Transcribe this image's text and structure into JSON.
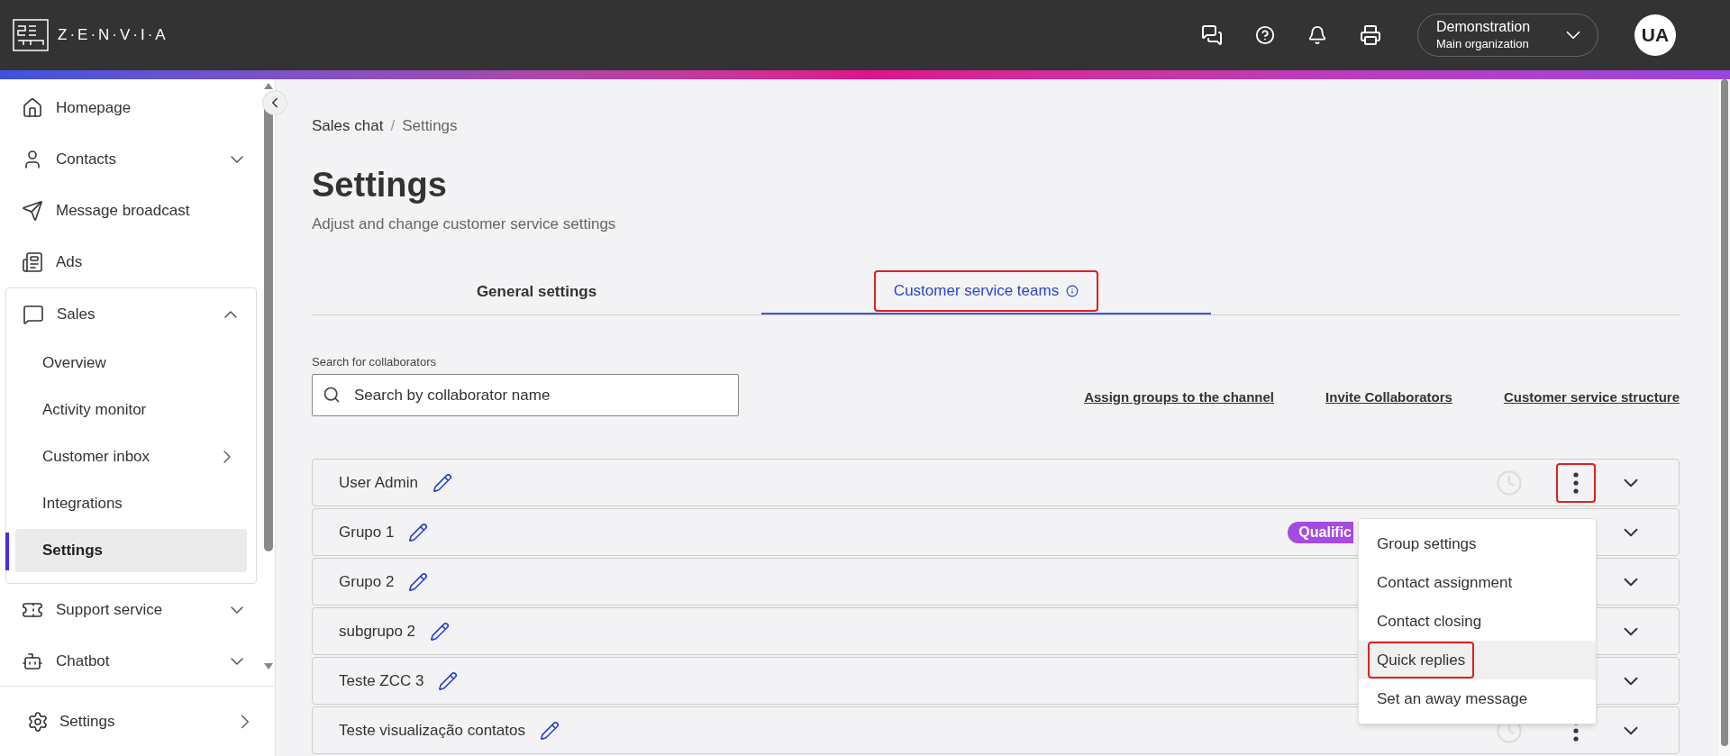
{
  "header": {
    "logo_text": "Z·E·N·V·I·A",
    "org_name": "Demonstration",
    "org_sub": "Main organization",
    "avatar": "UA"
  },
  "sidebar": {
    "items": [
      {
        "label": "Homepage",
        "selected": false
      },
      {
        "label": "Contacts",
        "selected": false,
        "expanded": false
      },
      {
        "label": "Message broadcast",
        "selected": false
      },
      {
        "label": "Ads",
        "selected": false
      },
      {
        "label": "Sales",
        "selected": false,
        "expanded": true,
        "children": [
          {
            "label": "Overview",
            "selected": false,
            "submenu": false
          },
          {
            "label": "Activity monitor",
            "selected": false,
            "submenu": false
          },
          {
            "label": "Customer inbox",
            "selected": false,
            "submenu": true
          },
          {
            "label": "Integrations",
            "selected": false,
            "submenu": false
          },
          {
            "label": "Settings",
            "selected": true,
            "submenu": false
          }
        ]
      },
      {
        "label": "Support service",
        "selected": false,
        "expanded": false
      },
      {
        "label": "Chatbot",
        "selected": false,
        "expanded": false
      }
    ],
    "footer": "Settings"
  },
  "breadcrumb": [
    "Sales chat",
    "Settings"
  ],
  "breadcrumb_separator": "/",
  "title": "Settings",
  "subtitle": "Adjust and change customer service settings",
  "tabs": [
    {
      "label": "General settings",
      "selected": false,
      "highlighted": false
    },
    {
      "label": "Customer service teams",
      "selected": true,
      "highlighted": true
    }
  ],
  "search": {
    "label": "Search for collaborators",
    "placeholder": "Search by collaborator name"
  },
  "links": [
    "Assign groups to the channel",
    "Invite Collaborators",
    "Customer service structure"
  ],
  "groups": [
    {
      "name": "User Admin",
      "actions": true,
      "highlighted": true
    },
    {
      "name": "Grupo 1",
      "tag": "Qualific",
      "highlighted": false
    },
    {
      "name": "Grupo 2",
      "highlighted": false
    },
    {
      "name": "subgrupo 2",
      "highlighted": false
    },
    {
      "name": "Teste ZCC 3",
      "highlighted": false
    },
    {
      "name": "Teste visualização contatos",
      "actions": true,
      "highlighted": false
    }
  ],
  "menu": {
    "items": [
      {
        "label": "Group settings",
        "selected": false,
        "highlighted": false
      },
      {
        "label": "Contact assignment",
        "selected": false,
        "highlighted": false
      },
      {
        "label": "Contact closing",
        "selected": false,
        "highlighted": false
      },
      {
        "label": "Quick replies",
        "selected": true,
        "highlighted": true
      },
      {
        "label": "Set an away message",
        "selected": false,
        "highlighted": false
      }
    ]
  }
}
